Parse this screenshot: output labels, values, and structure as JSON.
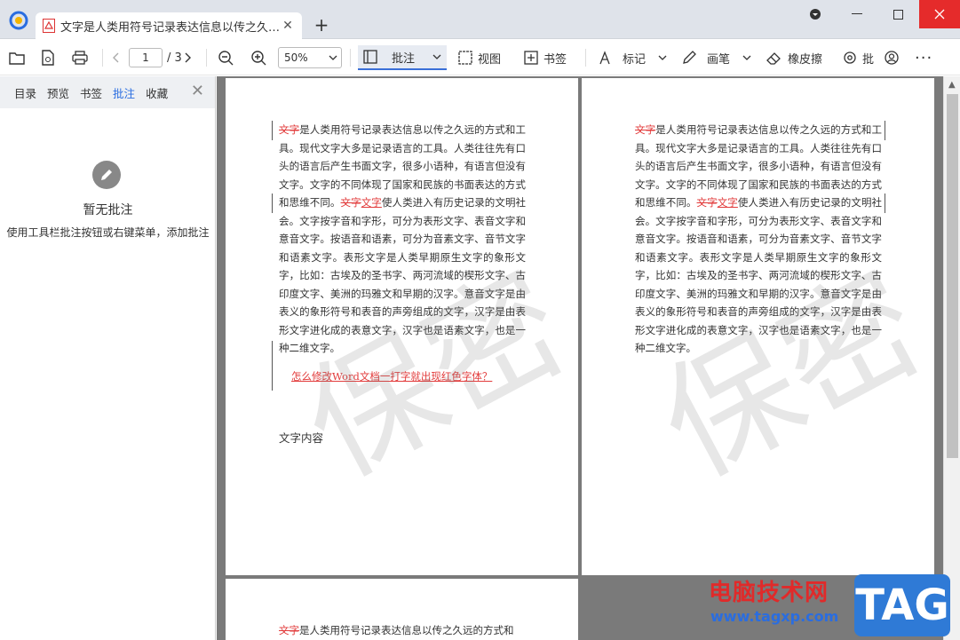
{
  "tab": {
    "title": "文字是人类用符号记录表达信息以传之久远..."
  },
  "toolbar": {
    "page_current": "1",
    "page_total": "/ 3",
    "zoom": "50%",
    "annotate_label": "批注",
    "view_label": "视图",
    "bookmark_label": "书签",
    "mark_label": "标记",
    "pen_label": "画笔",
    "eraser_label": "橡皮擦",
    "batch_label": "批"
  },
  "sidebar": {
    "tabs": [
      "目录",
      "预览",
      "书签",
      "批注",
      "收藏"
    ],
    "active_tab": "批注",
    "empty_title": "暂无批注",
    "empty_desc": "使用工具栏批注按钮或右键菜单，添加批注"
  },
  "page1": {
    "strike_word": "文字",
    "para": "是人类用符号记录表达信息以传之久远的方式和工具。现代文字大多是记录语言的工具。人类往往先有口头的语言后产生书面文字，很多小语种，有语言但没有文字。文字的不同体现了国家和民族的书面表达的方式和思维不同。",
    "strike2": "文字",
    "underline2": "文字",
    "para2": "使人类进入有历史记录的文明社会。文字按字音和字形，可分为表形文字、表音文字和意音文字。按语音和语素，可分为音素文字、音节文字和语素文字。表形文字是人类早期原生文字的象形文字，比如：古埃及的圣书字、两河流域的楔形文字、古印度文字、美洲的玛雅文和早期的汉字。意音文字是由表义的象形符号和表音的声旁组成的文字，汉字是由表形文字进化成的表意文字，汉字也是语素文字，也是一种二维文字。",
    "link": "怎么修改Word文档一打字就出现红色字体？",
    "footer_text": "文字内容",
    "watermark": "保密"
  },
  "page2": {
    "strike_word": "文字",
    "para": "是人类用符号记录表达信息以传之久远的方式和工具。现代文字大多是记录语言的工具。人类往往先有口头的语言后产生书面文字，很多小语种，有语言但没有文字。文字的不同体现了国家和民族的书面表达的方式和思维不同。",
    "strike2": "文字",
    "underline2": "文字",
    "para2": "使人类进入有历史记录的文明社会。文字按字音和字形，可分为表形文字、表音文字和意音文字。按语音和语素，可分为音素文字、音节文字和语素文字。表形文字是人类早期原生文字的象形文字，比如：古埃及的圣书字、两河流域的楔形文字、古印度文字、美洲的玛雅文和早期的汉字。意音文字是由表义的象形符号和表音的声旁组成的文字，汉字是由表形文字进化成的表意文字，汉字也是语素文字，也是一种二维文字。",
    "watermark": "保密"
  },
  "page3": {
    "strike_word": "文字",
    "para": "是人类用符号记录表达信息以传之久远的方式和"
  },
  "brand": {
    "cn": "电脑技术网",
    "url": "www.tagxp.com",
    "tag": "TAG"
  }
}
